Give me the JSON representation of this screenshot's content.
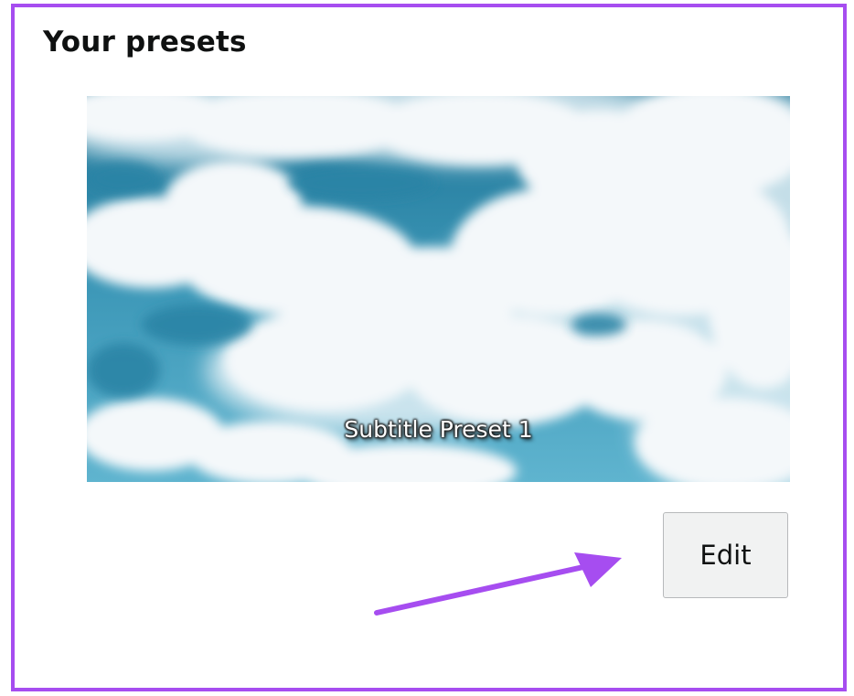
{
  "section": {
    "title": "Your presets"
  },
  "preset": {
    "caption": "Subtitle Preset 1",
    "background": "cloudy-sky-image"
  },
  "actions": {
    "edit_label": "Edit"
  },
  "colors": {
    "frame_border": "#a64df0",
    "annotation_arrow": "#a64df0",
    "sky": "#3c93b3",
    "button_bg": "#f1f2f2"
  }
}
